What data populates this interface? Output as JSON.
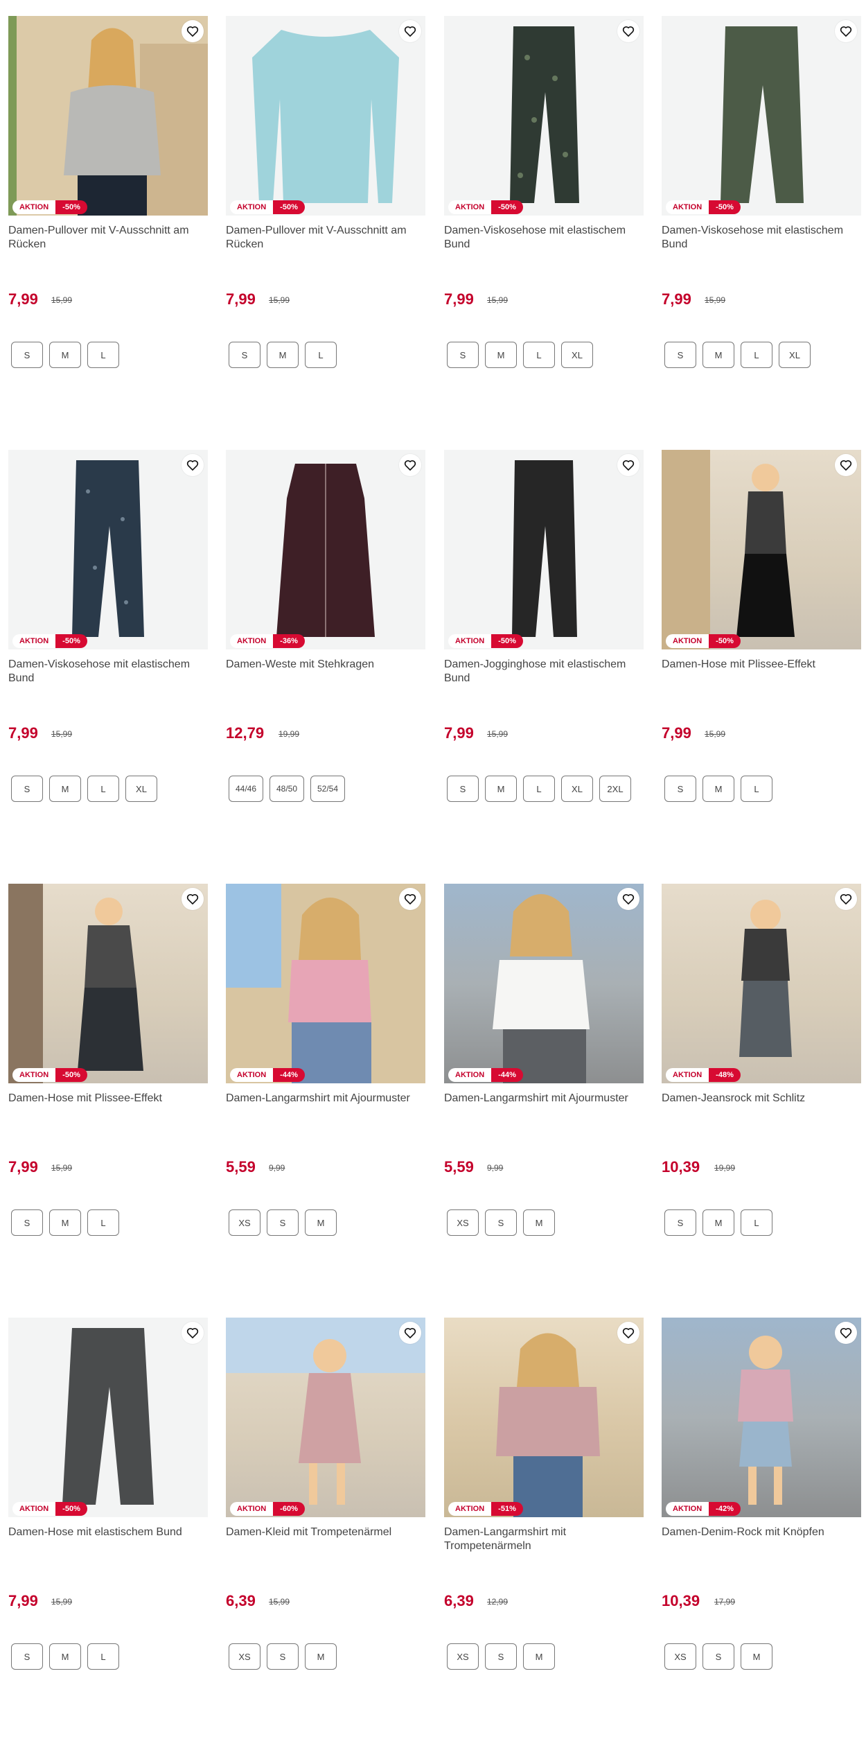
{
  "badge_label": "AKTION",
  "products": [
    {
      "title": "Damen-Pullover mit V-Ausschnitt am Rücken",
      "price": "7,99",
      "old_price": "15,99",
      "discount": "-50%",
      "sizes": [
        "S",
        "M",
        "L"
      ],
      "image": "pullover-grey-model"
    },
    {
      "title": "Damen-Pullover mit V-Ausschnitt am Rücken",
      "price": "7,99",
      "old_price": "15,99",
      "discount": "-50%",
      "sizes": [
        "S",
        "M",
        "L"
      ],
      "image": "pullover-light-blue"
    },
    {
      "title": "Damen-Viskosehose mit elastischem Bund",
      "price": "7,99",
      "old_price": "15,99",
      "discount": "-50%",
      "sizes": [
        "S",
        "M",
        "L",
        "XL"
      ],
      "image": "trousers-paisley"
    },
    {
      "title": "Damen-Viskosehose mit elastischem Bund",
      "price": "7,99",
      "old_price": "15,99",
      "discount": "-50%",
      "sizes": [
        "S",
        "M",
        "L",
        "XL"
      ],
      "image": "trousers-olive"
    },
    {
      "title": "Damen-Viskosehose mit elastischem Bund",
      "price": "7,99",
      "old_price": "15,99",
      "discount": "-50%",
      "sizes": [
        "S",
        "M",
        "L",
        "XL"
      ],
      "image": "trousers-navy-print"
    },
    {
      "title": "Damen-Weste mit Stehkragen",
      "price": "12,79",
      "old_price": "19,99",
      "discount": "-36%",
      "sizes": [
        "44/46",
        "48/50",
        "52/54"
      ],
      "image": "vest-burgundy"
    },
    {
      "title": "Damen-Jogginghose mit elastischem Bund",
      "price": "7,99",
      "old_price": "15,99",
      "discount": "-50%",
      "sizes": [
        "S",
        "M",
        "L",
        "XL",
        "2XL"
      ],
      "image": "joggers-black"
    },
    {
      "title": "Damen-Hose mit Plissee-Effekt",
      "price": "7,99",
      "old_price": "15,99",
      "discount": "-50%",
      "sizes": [
        "S",
        "M",
        "L"
      ],
      "image": "pleated-trousers-model"
    },
    {
      "title": "Damen-Hose mit Plissee-Effekt",
      "price": "7,99",
      "old_price": "15,99",
      "discount": "-50%",
      "sizes": [
        "S",
        "M",
        "L"
      ],
      "image": "pleated-trousers-model-2"
    },
    {
      "title": "Damen-Langarmshirt mit Ajourmuster",
      "price": "5,59",
      "old_price": "9,99",
      "discount": "-44%",
      "sizes": [
        "XS",
        "S",
        "M"
      ],
      "image": "pink-crop-top-model"
    },
    {
      "title": "Damen-Langarmshirt mit Ajourmuster",
      "price": "5,59",
      "old_price": "9,99",
      "discount": "-44%",
      "sizes": [
        "XS",
        "S",
        "M"
      ],
      "image": "white-crop-top-model"
    },
    {
      "title": "Damen-Jeansrock mit Schlitz",
      "price": "10,39",
      "old_price": "19,99",
      "discount": "-48%",
      "sizes": [
        "S",
        "M",
        "L"
      ],
      "image": "denim-skirt-model"
    },
    {
      "title": "Damen-Hose mit elastischem Bund",
      "price": "7,99",
      "old_price": "15,99",
      "discount": "-50%",
      "sizes": [
        "S",
        "M",
        "L"
      ],
      "image": "wide-trousers-grey"
    },
    {
      "title": "Damen-Kleid mit Trompetenärmel",
      "price": "6,39",
      "old_price": "15,99",
      "discount": "-60%",
      "sizes": [
        "XS",
        "S",
        "M"
      ],
      "image": "floral-dress-model"
    },
    {
      "title": "Damen-Langarmshirt mit Trompetenärmeln",
      "price": "6,39",
      "old_price": "12,99",
      "discount": "-51%",
      "sizes": [
        "XS",
        "S",
        "M"
      ],
      "image": "floral-blouse-model"
    },
    {
      "title": "Damen-Denim-Rock mit Knöpfen",
      "price": "10,39",
      "old_price": "17,99",
      "discount": "-42%",
      "sizes": [
        "XS",
        "S",
        "M"
      ],
      "image": "denim-button-skirt-model"
    }
  ],
  "colors": {
    "accent": "#c4002b",
    "badge_red": "#d70a32",
    "image_bg": "#f3f4f4"
  },
  "icons": {
    "favorite": "heart-outline-icon"
  }
}
